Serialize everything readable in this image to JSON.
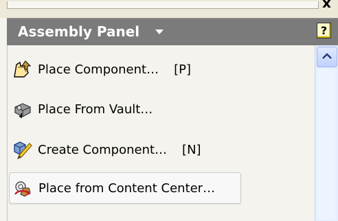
{
  "panel": {
    "title": "Assembly Panel",
    "help_glyph": "?",
    "close_glyph": "x"
  },
  "items": [
    {
      "label": "Place Component…",
      "shortcut": "[P]",
      "icon": "place-component-icon"
    },
    {
      "label": "Place From Vault…",
      "shortcut": "",
      "icon": "place-from-vault-icon"
    },
    {
      "label": "Create Component…",
      "shortcut": "[N]",
      "icon": "create-component-icon"
    },
    {
      "label": "Place from Content Center…",
      "shortcut": "",
      "icon": "content-center-icon"
    }
  ],
  "colors": {
    "header_bg": "#7b7b7b",
    "panel_bg": "#f4f3ee",
    "scrollbar": "#e5efff"
  }
}
